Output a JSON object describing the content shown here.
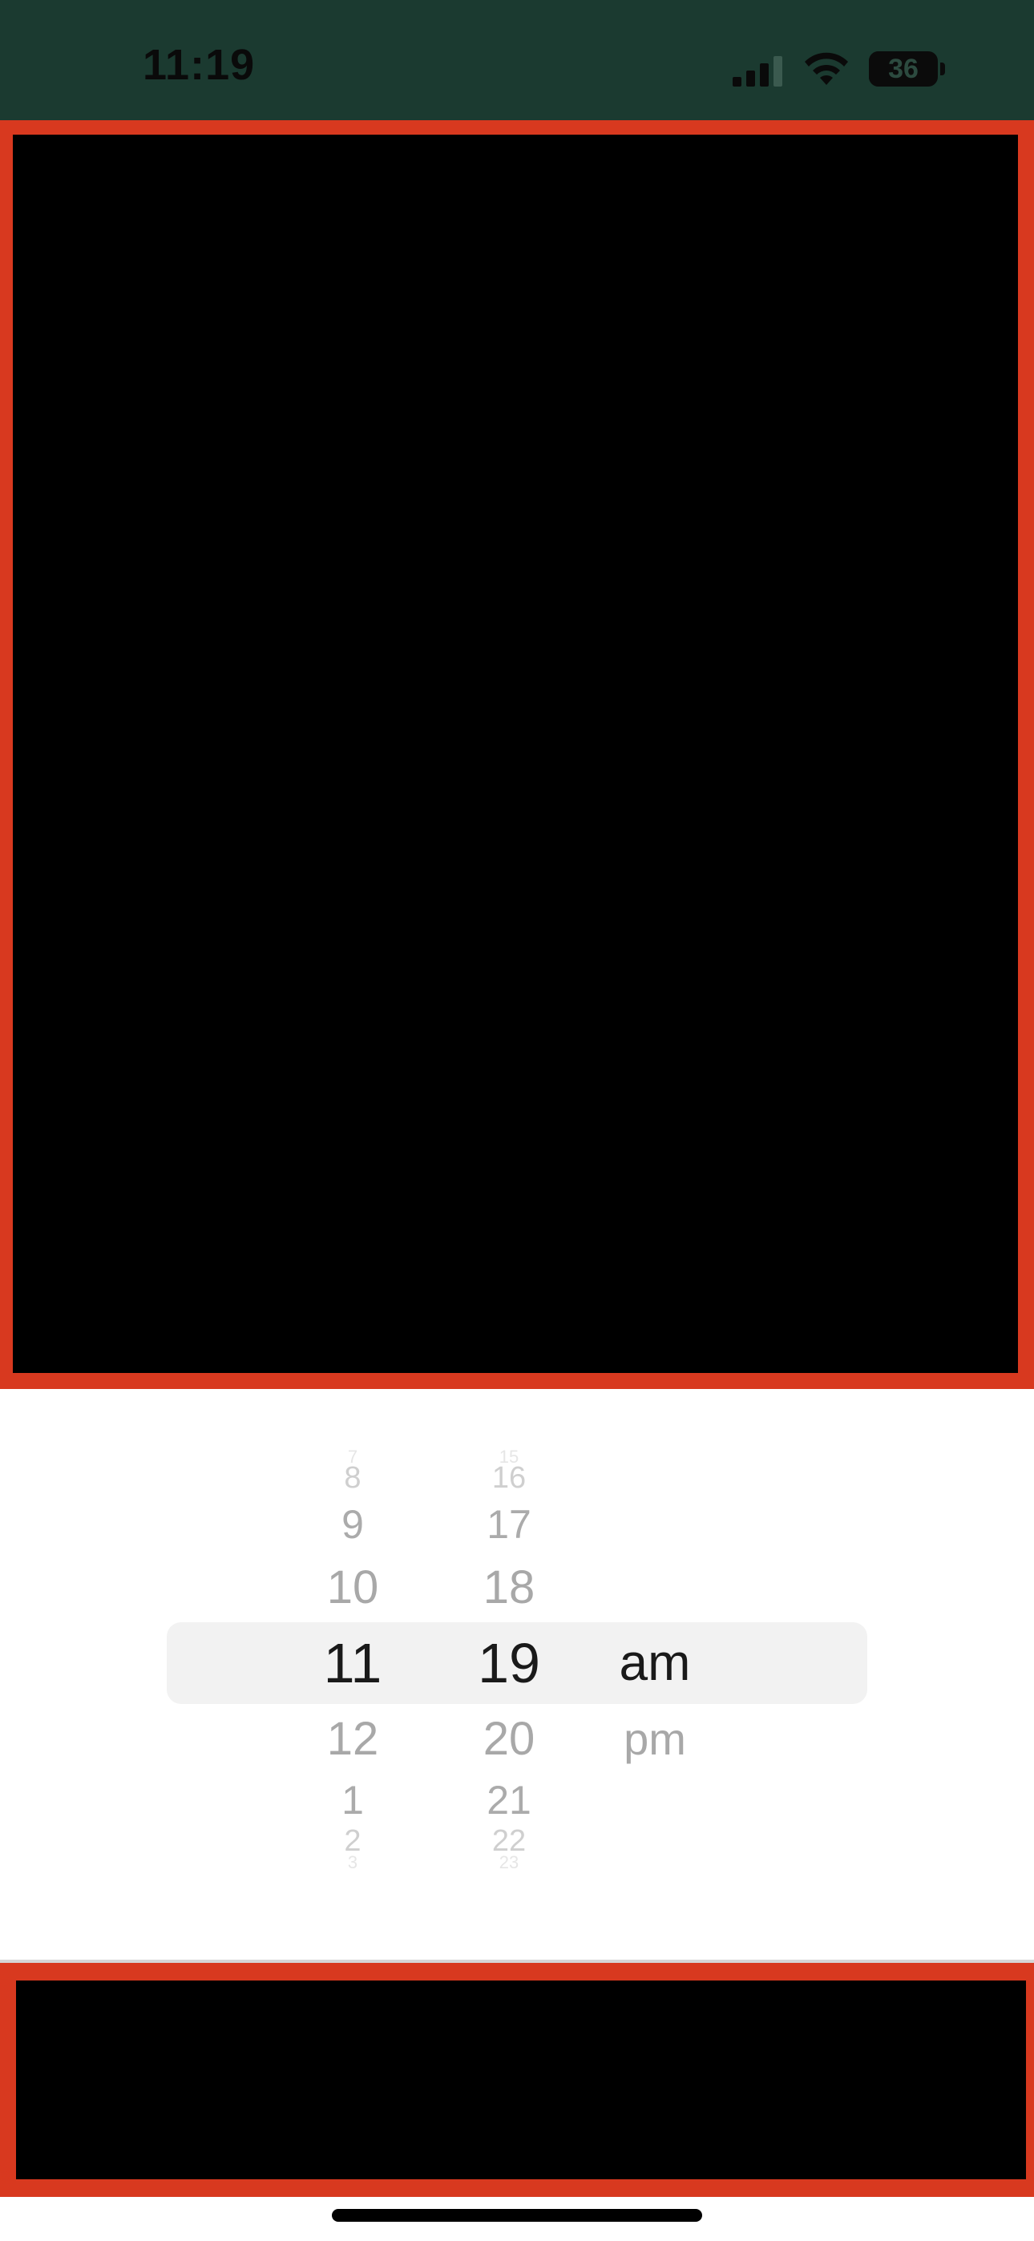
{
  "status_bar": {
    "time": "11:19",
    "battery_level": "36",
    "signal_icon": "cellular-signal-icon",
    "wifi_icon": "wifi-icon",
    "background_color": "#1b3a30"
  },
  "preview": {
    "accent_color": "#d8391f",
    "screen_color": "#000000"
  },
  "time_picker": {
    "hours": [
      "7",
      "8",
      "9",
      "10",
      "11",
      "12",
      "1",
      "2",
      "3"
    ],
    "minutes": [
      "15",
      "16",
      "17",
      "18",
      "19",
      "20",
      "21",
      "22",
      "23"
    ],
    "periods": [
      "am",
      "pm"
    ],
    "selected": {
      "hour": "11",
      "minute": "19",
      "period": "am"
    }
  },
  "bottom_panel": {
    "accent_color": "#d8391f",
    "screen_color": "#000000"
  }
}
